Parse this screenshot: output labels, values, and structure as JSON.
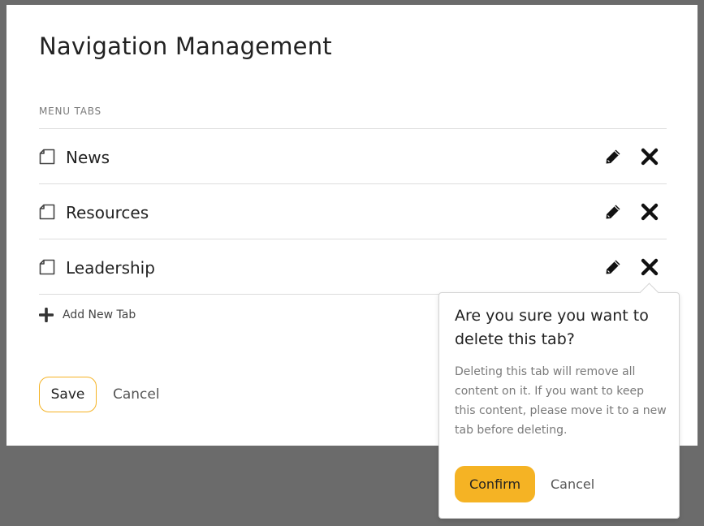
{
  "modal": {
    "title": "Navigation Management",
    "section_label": "MENU TABS",
    "tabs": [
      {
        "label": "News"
      },
      {
        "label": "Resources"
      },
      {
        "label": "Leadership"
      }
    ],
    "add_tab_label": "Add New Tab",
    "save_label": "Save",
    "cancel_label": "Cancel"
  },
  "popover": {
    "title": "Are you sure you want to delete this tab?",
    "body": "Deleting this tab will remove all content on it. If you want to keep this content, please move it to a new tab before deleting.",
    "confirm_label": "Confirm",
    "cancel_label": "Cancel"
  },
  "icons": {
    "tab": "page-icon",
    "edit": "pencil-icon",
    "delete": "close-icon",
    "add": "plus-icon"
  },
  "colors": {
    "accent": "#f5b324",
    "overlay": "#6b6b6b"
  }
}
